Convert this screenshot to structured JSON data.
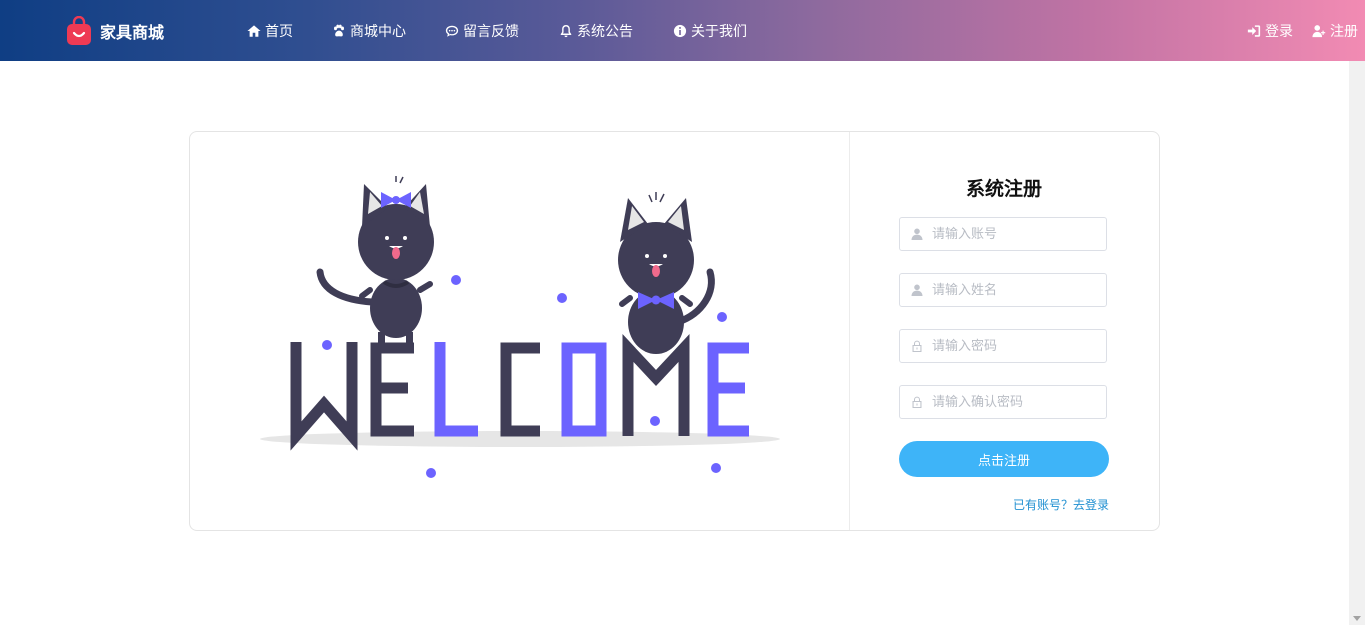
{
  "brand": {
    "name": "家具商城",
    "logo_icon": "shopping-bag-icon",
    "logo_color": "#ee3a54"
  },
  "nav": {
    "links": [
      {
        "label": "首页",
        "icon": "home-icon"
      },
      {
        "label": "商城中心",
        "icon": "paw-icon"
      },
      {
        "label": "留言反馈",
        "icon": "chat-icon"
      },
      {
        "label": "系统公告",
        "icon": "bell-icon"
      },
      {
        "label": "关于我们",
        "icon": "info-icon"
      }
    ],
    "login": {
      "label": "登录",
      "icon": "sign-in-icon"
    },
    "register": {
      "label": "注册",
      "icon": "user-plus-icon"
    }
  },
  "illustration": {
    "letters": "WELCOME",
    "dark_color": "#3f3d56",
    "accent_color": "#6c63ff"
  },
  "form": {
    "title": "系统注册",
    "fields": [
      {
        "placeholder": "请输入账号",
        "icon": "user-icon",
        "value": ""
      },
      {
        "placeholder": "请输入姓名",
        "icon": "user-icon",
        "value": ""
      },
      {
        "placeholder": "请输入密码",
        "icon": "lock-icon",
        "value": ""
      },
      {
        "placeholder": "请输入确认密码",
        "icon": "lock-icon",
        "value": ""
      }
    ],
    "submit_label": "点击注册",
    "login_link": "已有账号？去登录",
    "accent": "#3eb4f8"
  }
}
